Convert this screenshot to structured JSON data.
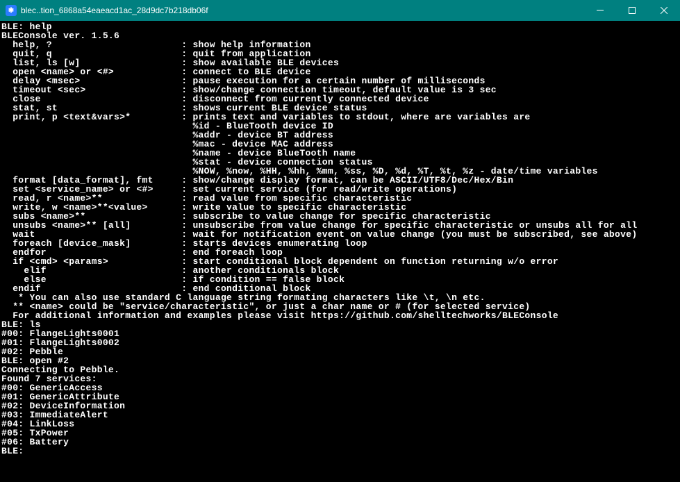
{
  "titlebar": {
    "icon_glyph": "✱",
    "title": "blec..tion_6868a54eaeacd1ac_28d9dc7b218db06f",
    "minimize": "min",
    "maximize": "max",
    "close": "close"
  },
  "session": {
    "prompt1": "BLE: help",
    "version": "BLEConsole ver. 1.5.6",
    "blank1": "",
    "help": [
      "  help, ?                       : show help information",
      "  quit, q                       : quit from application",
      "  list, ls [w]                  : show available BLE devices",
      "  open <name> or <#>            : connect to BLE device",
      "  delay <msec>                  : pause execution for a certain number of milliseconds",
      "  timeout <sec>                 : show/change connection timeout, default value is 3 sec",
      "  close                         : disconnect from currently connected device",
      "  stat, st                      : shows current BLE device status",
      "  print, p <text&vars>*         : prints text and variables to stdout, where are variables are",
      "                                  %id - BlueTooth device ID",
      "                                  %addr - device BT address",
      "                                  %mac - device MAC address",
      "                                  %name - device BlueTooth name",
      "                                  %stat - device connection status",
      "                                  %NOW, %now, %HH, %hh, %mm, %ss, %D, %d, %T, %t, %z - date/time variables",
      "  format [data_format], fmt     : show/change display format, can be ASCII/UTF8/Dec/Hex/Bin",
      "  set <service_name> or <#>     : set current service (for read/write operations)",
      "  read, r <name>**              : read value from specific characteristic",
      "  write, w <name>**<value>      : write value to specific characteristic",
      "  subs <name>**                 : subscribe to value change for specific characteristic",
      "  unsubs <name>** [all]         : unsubscribe from value change for specific characteristic or unsubs all for all",
      "  wait                          : wait for notification event on value change (you must be subscribed, see above)",
      "  foreach [device_mask]         : starts devices enumerating loop",
      "  endfor                        : end foreach loop",
      "  if <cmd> <params>             : start conditional block dependent on function returning w/o error",
      "    elif                        : another conditionals block",
      "    else                        : if condition == false block",
      "  endif                         : end conditional block",
      "",
      "   * You can also use standard C language string formating characters like \\t, \\n etc.",
      "  ** <name> could be \"service/characteristic\", or just a char name or # (for selected service)",
      "",
      "  For additional information and examples please visit https://github.com/shelltechworks/BLEConsole",
      ""
    ],
    "prompt2": "BLE: ls",
    "ls_output": [
      "#00: FlangeLights0001",
      "#01: FlangeLights0002",
      "#02: Pebble"
    ],
    "prompt3": "BLE: open #2",
    "open_output": [
      "Connecting to Pebble.",
      "Found 7 services:",
      "#00: GenericAccess",
      "#01: GenericAttribute",
      "#02: DeviceInformation",
      "#03: ImmediateAlert",
      "#04: LinkLoss",
      "#05: TxPower",
      "#06: Battery"
    ],
    "prompt4": "BLE: "
  }
}
